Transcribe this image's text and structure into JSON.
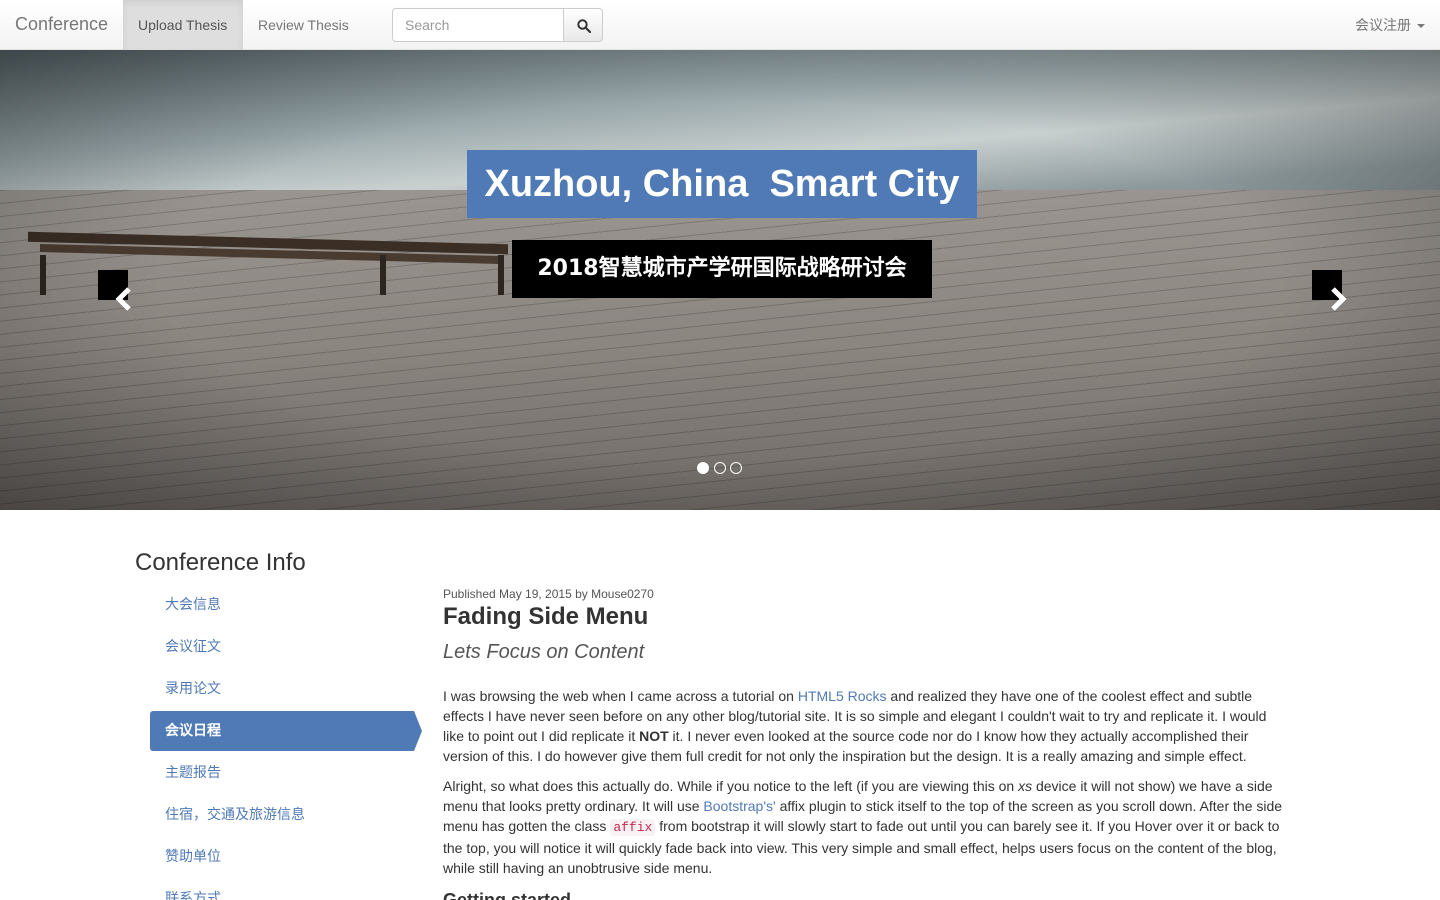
{
  "navbar": {
    "brand": "Conference",
    "links": [
      "Upload Thesis",
      "Review Thesis"
    ],
    "search_placeholder": "Search",
    "register_label": "会议注册"
  },
  "carousel": {
    "title": "Xuzhou, China  Smart City",
    "subtitle": "2018智慧城市产学研国际战略研讨会",
    "slide_count": 3,
    "active_slide": 1
  },
  "sidebar": {
    "title": "Conference Info",
    "items": [
      "大会信息",
      "会议征文",
      "录用论文",
      "会议日程",
      "主题报告",
      "住宿，交通及旅游信息",
      "赞助单位",
      "联系方式"
    ],
    "active_index": 3
  },
  "article": {
    "meta": "Published May 19, 2015 by Mouse0270",
    "title": "Fading Side Menu",
    "subtitle": "Lets Focus on Content",
    "p1_a": "I was browsing the web when I came across a tutorial on ",
    "p1_link": "HTML5 Rocks",
    "p1_b": " and realized they have one of the coolest effect and subtle effects I have never seen before on any other blog/tutorial site. It is so simple and elegant I couldn't wait to try and replicate it. I would like to point out I did replicate it ",
    "p1_strong": "NOT",
    "p1_c": " it. I never even looked at the source code nor do I know how they actually accomplished their version of this. I do however give them full credit for not only the inspiration but the design. It is a really amazing and simple effect.",
    "p2_a": "Alright, so what does this actually do. While if you notice to the left (if you are viewing this on ",
    "p2_em": "xs",
    "p2_b": " device it will not show) we have a side menu that looks pretty ordinary. It will use ",
    "p2_link": "Bootstrap's'",
    "p2_c": " affix plugin to stick itself to the top of the screen as you scroll down. After the side menu has gotten the class ",
    "p2_code": "affix",
    "p2_d": " from bootstrap it will slowly start to fade out until you can barely see it. If you Hover over it or back to the top, you will notice it will quickly fade back into view. This very simple and small effect, helps users focus on the content of the blog, while still having an unobtrusive side menu.",
    "section_heading": "Getting started"
  },
  "colors": {
    "accent": "#4f7ab5",
    "navbar_bg": "#f8f8f8",
    "hero_subtitle_bg": "#000000"
  }
}
